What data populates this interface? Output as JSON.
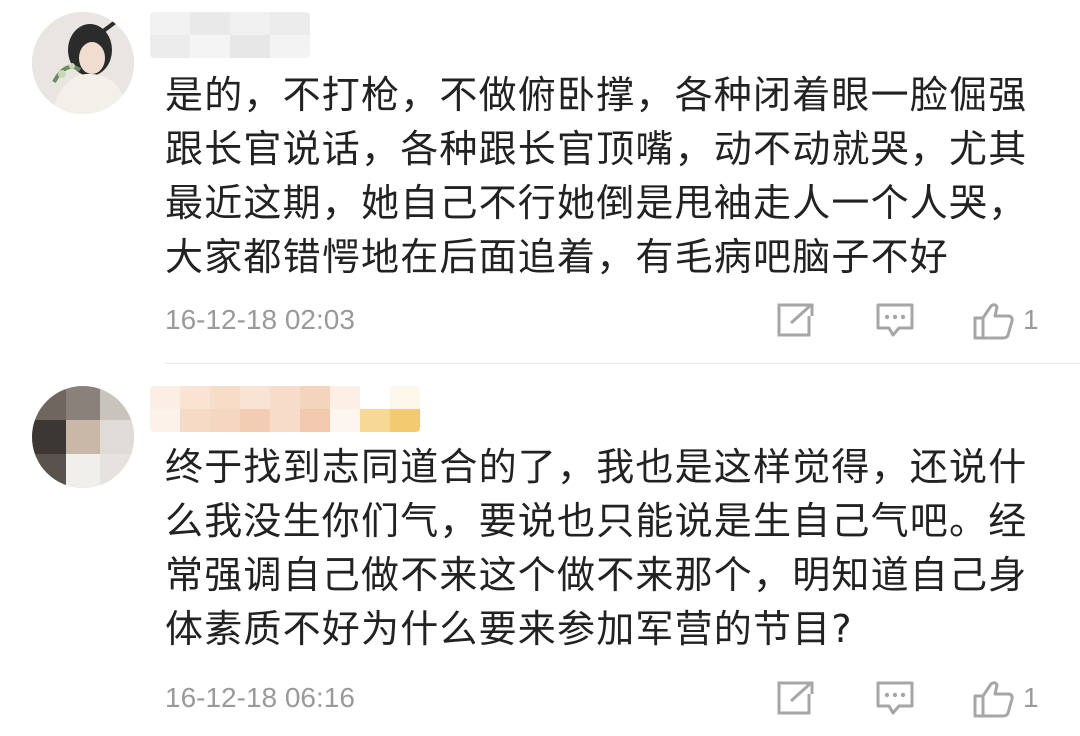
{
  "comments": [
    {
      "text": "是的，不打枪，不做俯卧撑，各种闭着眼一脸倔强跟长官说话，各种跟长官顶嘴，动不动就哭，尤其最近这期，她自己不行她倒是甩袖走人一个人哭，大家都错愕地在后面追着，有毛病吧脑子不好",
      "time": "16-12-18 02:03",
      "likes": "1",
      "icons": {
        "share": "share-icon",
        "reply": "reply-icon",
        "like": "thumb-up-icon"
      }
    },
    {
      "text": "终于找到志同道合的了，我也是这样觉得，还说什么我没生你们气，要说也只能说是生自己气吧。经常强调自己做不来这个做不来那个，明知道自己身体素质不好为什么要来参加军营的节目?",
      "time": "16-12-18 06:16",
      "likes": "1",
      "icons": {
        "share": "share-icon",
        "reply": "reply-icon",
        "like": "thumb-up-icon"
      }
    }
  ],
  "colors": {
    "text": "#222222",
    "meta": "#9a9a9a",
    "icon": "#a6a6a6",
    "divider": "#e8e8e8"
  }
}
